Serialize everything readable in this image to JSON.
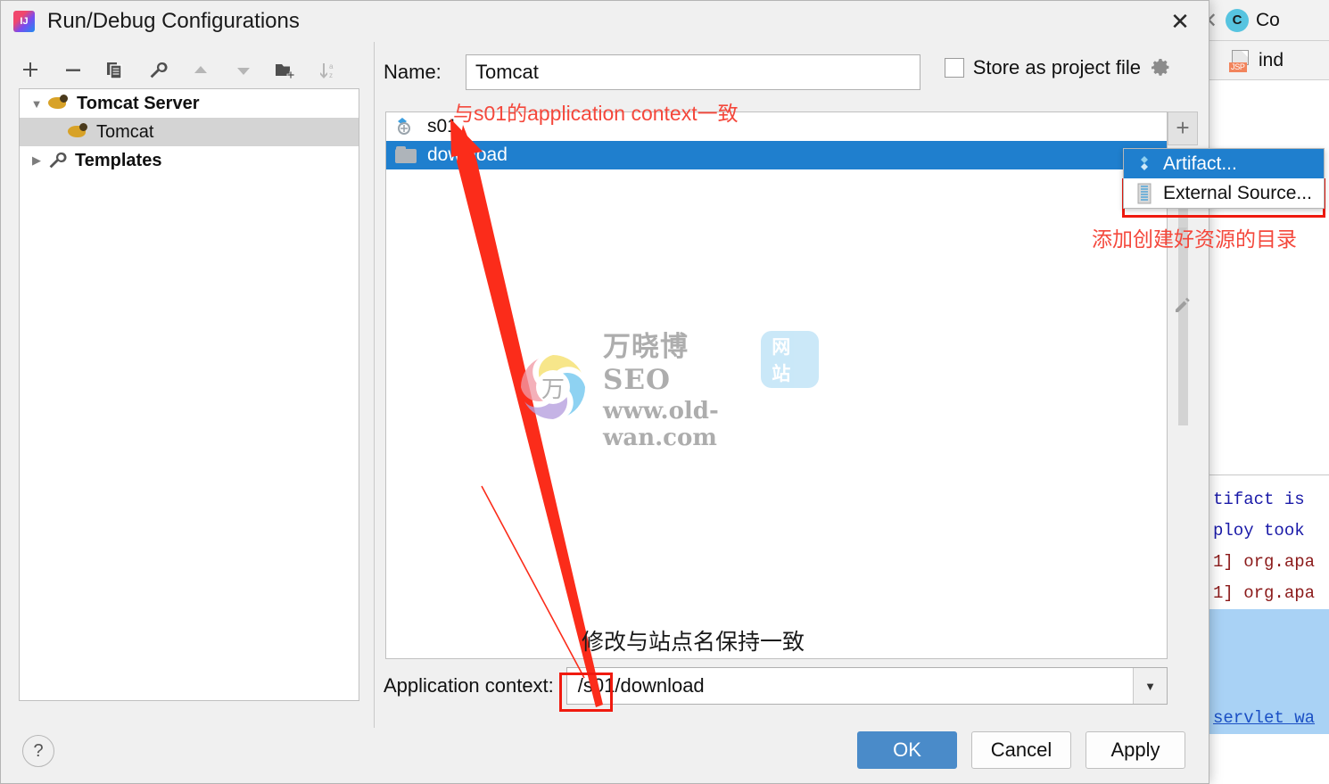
{
  "window": {
    "title": "Run/Debug Configurations",
    "app_icon": "intellij-idea-icon",
    "close_icon": "close-icon"
  },
  "left_toolbar": {
    "items": [
      {
        "name": "add-configuration-button",
        "icon": "plus-icon"
      },
      {
        "name": "remove-configuration-button",
        "icon": "minus-icon"
      },
      {
        "name": "copy-configuration-button",
        "icon": "copy-icon"
      },
      {
        "name": "edit-templates-button",
        "icon": "wrench-icon"
      },
      {
        "name": "move-up-button",
        "icon": "arrow-up-icon"
      },
      {
        "name": "move-down-button",
        "icon": "arrow-down-icon"
      },
      {
        "name": "new-folder-button",
        "icon": "folder-add-icon"
      },
      {
        "name": "sort-configurations-button",
        "icon": "sort-az-icon"
      }
    ]
  },
  "config_tree": [
    {
      "label": "Tomcat Server",
      "icon": "tomcat-icon",
      "expanded": true,
      "selected": false,
      "bold": true,
      "indent": 0
    },
    {
      "label": "Tomcat",
      "icon": "tomcat-icon",
      "expanded": null,
      "selected": true,
      "bold": false,
      "indent": 1
    },
    {
      "label": "Templates",
      "icon": "wrench-icon",
      "expanded": false,
      "selected": false,
      "bold": true,
      "indent": 0
    }
  ],
  "help_button": {
    "label": "?",
    "name": "help-button"
  },
  "name_field": {
    "label": "Name:",
    "value": "Tomcat",
    "placeholder": ""
  },
  "store_as_project_file": {
    "label": "Store as project file",
    "checked": false,
    "gear_icon": "gear-icon"
  },
  "deployment": {
    "rows": [
      {
        "label": "s01",
        "icon": "artifact-icon",
        "selected": false
      },
      {
        "label": "download",
        "icon": "folder-icon",
        "selected": true
      }
    ],
    "side_buttons": [
      {
        "name": "add-deployment-button",
        "icon": "plus-icon",
        "active": true
      },
      {
        "name": "remove-deployment-button",
        "icon": "minus-icon",
        "active": false
      },
      {
        "name": "move-up-deployment-button",
        "icon": "arrow-up-icon",
        "active": false
      },
      {
        "name": "move-down-deployment-button",
        "icon": "arrow-down-icon",
        "active": false
      },
      {
        "name": "edit-deployment-button",
        "icon": "pencil-icon",
        "active": false
      }
    ]
  },
  "add_menu": {
    "items": [
      {
        "label": "Artifact...",
        "icon": "artifact-icon",
        "highlighted": true
      },
      {
        "label": "External Source...",
        "icon": "external-source-icon",
        "highlighted": false
      }
    ]
  },
  "application_context": {
    "label": "Application context:",
    "value": "/s01/download",
    "highlight_part": "/s01",
    "rest_part": "/download",
    "dropdown_icon": "chevron-down-icon"
  },
  "buttons": {
    "ok": "OK",
    "cancel": "Cancel",
    "apply": "Apply"
  },
  "annotations": [
    {
      "name": "annotation-context-match",
      "text": "与s01的application context一致",
      "color": "#f4483c"
    },
    {
      "name": "annotation-add-resource-dir",
      "text": "添加创建好资源的目录",
      "color": "#f4483c"
    },
    {
      "name": "annotation-match-site-name",
      "text": "修改与站点名保持一致",
      "color": "#1a1a1a"
    }
  ],
  "watermark": {
    "brand_cn": "万晓博SEO",
    "badge": "网站",
    "url": "www.old-wan.com",
    "mark_char": "万"
  },
  "background_ide": {
    "tab_label": "Co",
    "tab_icon": "class-icon",
    "file_label": "ind",
    "file_icon": "jsp-file-icon",
    "console_lines": [
      {
        "text": "tifact is",
        "style": "blue"
      },
      {
        "text": "ploy took",
        "style": "blue"
      },
      {
        "text": "1] org.apa",
        "style": "red"
      },
      {
        "text": "1] org.apa",
        "style": "red"
      },
      {
        "text": "",
        "style": "selected"
      },
      {
        "text": "servlet_wa",
        "style": "link"
      }
    ]
  },
  "colors": {
    "selection_blue": "#1f7fce",
    "primary_button": "#4a8bc9",
    "annotation_red": "#f4483c",
    "box_red": "#f01a0f",
    "dialog_bg": "#f0f0f0"
  }
}
